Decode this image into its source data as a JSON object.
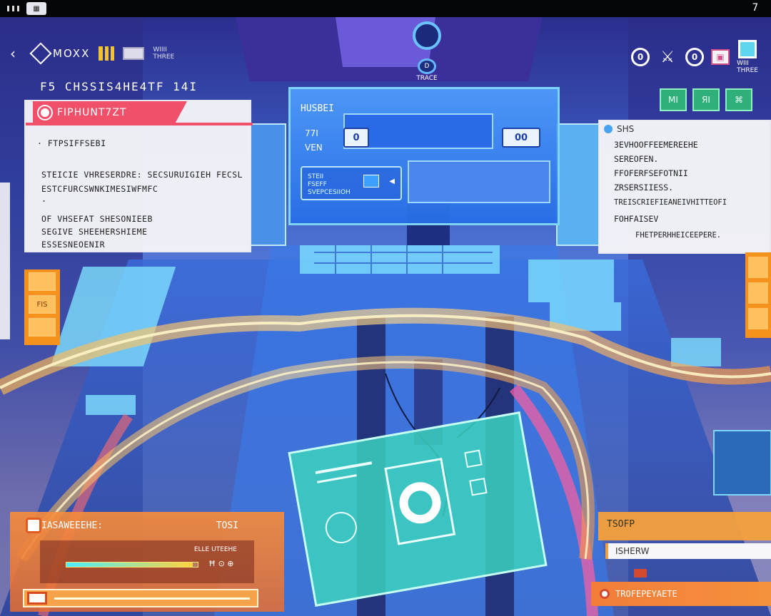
{
  "system_bar": {
    "clock": "7"
  },
  "top_nav": {
    "logo_text": "MOXX",
    "sub_text": "WIIII\nTHREE",
    "center_chip": "TRACE"
  },
  "top_right": {
    "icons": [
      {
        "name": "ring-badge-icon",
        "label": "0"
      },
      {
        "name": "crossed-swords-icon",
        "label": "⚔"
      },
      {
        "name": "ring-badge-icon",
        "label": "0"
      },
      {
        "name": "pink-card-icon",
        "label": "▣"
      },
      {
        "name": "cyan-square-icon",
        "label": ""
      }
    ],
    "sub_text": "WIII\nTHREE"
  },
  "subtitle": "F5 CHSSIS4HE4TF 14I",
  "green_buttons": [
    "MI",
    "ЯI",
    "⌘"
  ],
  "left_panel": {
    "title": "FIPHUNT7ZT",
    "lines": [
      "· FTPSIFFSEBI",
      "STEICIE VHRESERDRE: SECSURUIGIEH FECSL",
      "ESTCFURCSWNKIMESIWFMFC",
      "-",
      "OF VHSEFAT SHESONIEEB",
      "SEGIVE  SHEEHERSHIEME",
      "ESSESNEOENIR"
    ]
  },
  "right_panel": {
    "title": "SHS",
    "lines": [
      "3EVHOOFFEEMEREEHE",
      "SEREOFEN.",
      "FFOFERFSEFOTNII",
      "ZRSERSIIESS.",
      "TREISCRIEFIEANEIVHITTEOFI",
      "FOHFAISEV",
      "FHETPERHHEICEEPERE."
    ]
  },
  "monitor": {
    "title": "HUSBEI",
    "sub": "77I\nVEN",
    "btn_left": "0",
    "btn_right": "00",
    "field_label": "STEII\nFSEFF\nSVEPCESIIOH"
  },
  "bottom_left": {
    "title": "IASAWEEEHE:",
    "right_label": "TOSI",
    "inner_small": "ELLE UTEEHE",
    "progress": 0.96,
    "progress_caption": "Ħ ⊙  ⊕"
  },
  "bottom_right": {
    "top_label": "TSOFP",
    "mid_label": "ISHERW",
    "bottom_label": "TROFEPEYAETE"
  },
  "side_tabs": [
    "",
    "FIS",
    ""
  ],
  "colors": {
    "accent_red": "#f0506a",
    "accent_orange": "#f5921e",
    "accent_green": "#2fb07a",
    "accent_cyan": "#5fd6f0",
    "monitor_blue": "#2a6ae6"
  }
}
